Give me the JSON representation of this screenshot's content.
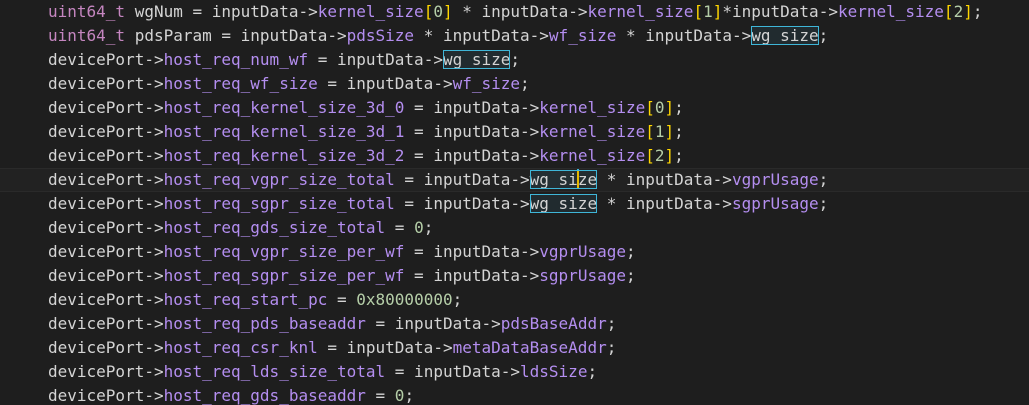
{
  "editor": {
    "colors": {
      "background": "#1e1e1e",
      "type": "#c586c0",
      "field": "#b48ef0",
      "number": "#b5cea8",
      "bracket": "#ffd700",
      "highlight": "#3fb6d8"
    },
    "lines": [
      [
        [
          "type",
          "uint64_t"
        ],
        [
          "var",
          " wgNum = inputData->"
        ],
        [
          "field",
          "kernel_size"
        ],
        [
          "br",
          "["
        ],
        [
          "num",
          "0"
        ],
        [
          "br",
          "]"
        ],
        [
          "var",
          " * inputData->"
        ],
        [
          "field",
          "kernel_size"
        ],
        [
          "br",
          "["
        ],
        [
          "num",
          "1"
        ],
        [
          "br",
          "]"
        ],
        [
          "var",
          "*inputData->"
        ],
        [
          "field",
          "kernel_size"
        ],
        [
          "br",
          "["
        ],
        [
          "num",
          "2"
        ],
        [
          "br",
          "]"
        ],
        [
          "var",
          ";"
        ]
      ],
      [
        [
          "type",
          "uint64_t"
        ],
        [
          "var",
          " pdsParam = inputData->"
        ],
        [
          "field",
          "pdsSize"
        ],
        [
          "var",
          " * inputData->"
        ],
        [
          "field",
          "wf_size"
        ],
        [
          "var",
          " * inputData->"
        ],
        [
          "hl",
          "wg_size"
        ],
        [
          "var",
          ";"
        ]
      ],
      [
        [
          "var",
          "devicePort->"
        ],
        [
          "field",
          "host_req_num_wf"
        ],
        [
          "var",
          " = inputData->"
        ],
        [
          "hl",
          "wg_size"
        ],
        [
          "var",
          ";"
        ]
      ],
      [
        [
          "var",
          "devicePort->"
        ],
        [
          "field",
          "host_req_wf_size"
        ],
        [
          "var",
          " = inputData->"
        ],
        [
          "field",
          "wf_size"
        ],
        [
          "var",
          ";"
        ]
      ],
      [
        [
          "var",
          "devicePort->"
        ],
        [
          "field",
          "host_req_kernel_size_3d_0"
        ],
        [
          "var",
          " = inputData->"
        ],
        [
          "field",
          "kernel_size"
        ],
        [
          "br",
          "["
        ],
        [
          "num",
          "0"
        ],
        [
          "br",
          "]"
        ],
        [
          "var",
          ";"
        ]
      ],
      [
        [
          "var",
          "devicePort->"
        ],
        [
          "field",
          "host_req_kernel_size_3d_1"
        ],
        [
          "var",
          " = inputData->"
        ],
        [
          "field",
          "kernel_size"
        ],
        [
          "br",
          "["
        ],
        [
          "num",
          "1"
        ],
        [
          "br",
          "]"
        ],
        [
          "var",
          ";"
        ]
      ],
      [
        [
          "var",
          "devicePort->"
        ],
        [
          "field",
          "host_req_kernel_size_3d_2"
        ],
        [
          "var",
          " = inputData->"
        ],
        [
          "field",
          "kernel_size"
        ],
        [
          "br",
          "["
        ],
        [
          "num",
          "2"
        ],
        [
          "br",
          "]"
        ],
        [
          "var",
          ";"
        ]
      ],
      [
        [
          "var",
          "devicePort->"
        ],
        [
          "field",
          "host_req_vgpr_size_total"
        ],
        [
          "var",
          " = inputData->"
        ],
        [
          "hlc",
          "wg_size"
        ],
        [
          "var",
          " * inputData->"
        ],
        [
          "field",
          "vgprUsage"
        ],
        [
          "var",
          ";"
        ]
      ],
      [
        [
          "var",
          "devicePort->"
        ],
        [
          "field",
          "host_req_sgpr_size_total"
        ],
        [
          "var",
          " = inputData->"
        ],
        [
          "hl",
          "wg_size"
        ],
        [
          "var",
          " * inputData->"
        ],
        [
          "field",
          "sgprUsage"
        ],
        [
          "var",
          ";"
        ]
      ],
      [
        [
          "var",
          "devicePort->"
        ],
        [
          "field",
          "host_req_gds_size_total"
        ],
        [
          "var",
          " = "
        ],
        [
          "num",
          "0"
        ],
        [
          "var",
          ";"
        ]
      ],
      [
        [
          "var",
          "devicePort->"
        ],
        [
          "field",
          "host_req_vgpr_size_per_wf"
        ],
        [
          "var",
          " = inputData->"
        ],
        [
          "field",
          "vgprUsage"
        ],
        [
          "var",
          ";"
        ]
      ],
      [
        [
          "var",
          "devicePort->"
        ],
        [
          "field",
          "host_req_sgpr_size_per_wf"
        ],
        [
          "var",
          " = inputData->"
        ],
        [
          "field",
          "sgprUsage"
        ],
        [
          "var",
          ";"
        ]
      ],
      [
        [
          "var",
          "devicePort->"
        ],
        [
          "field",
          "host_req_start_pc"
        ],
        [
          "var",
          " = "
        ],
        [
          "num",
          "0x80000000"
        ],
        [
          "var",
          ";"
        ]
      ],
      [
        [
          "var",
          "devicePort->"
        ],
        [
          "field",
          "host_req_pds_baseaddr"
        ],
        [
          "var",
          " = inputData->"
        ],
        [
          "field",
          "pdsBaseAddr"
        ],
        [
          "var",
          ";"
        ]
      ],
      [
        [
          "var",
          "devicePort->"
        ],
        [
          "field",
          "host_req_csr_knl"
        ],
        [
          "var",
          " = inputData->"
        ],
        [
          "field",
          "metaDataBaseAddr"
        ],
        [
          "var",
          ";"
        ]
      ],
      [
        [
          "var",
          "devicePort->"
        ],
        [
          "field",
          "host_req_lds_size_total"
        ],
        [
          "var",
          " = inputData->"
        ],
        [
          "field",
          "ldsSize"
        ],
        [
          "var",
          ";"
        ]
      ],
      [
        [
          "var",
          "devicePort->"
        ],
        [
          "field",
          "host_req_gds_baseaddr"
        ],
        [
          "var",
          " = "
        ],
        [
          "num",
          "0"
        ],
        [
          "var",
          ";"
        ]
      ]
    ]
  }
}
